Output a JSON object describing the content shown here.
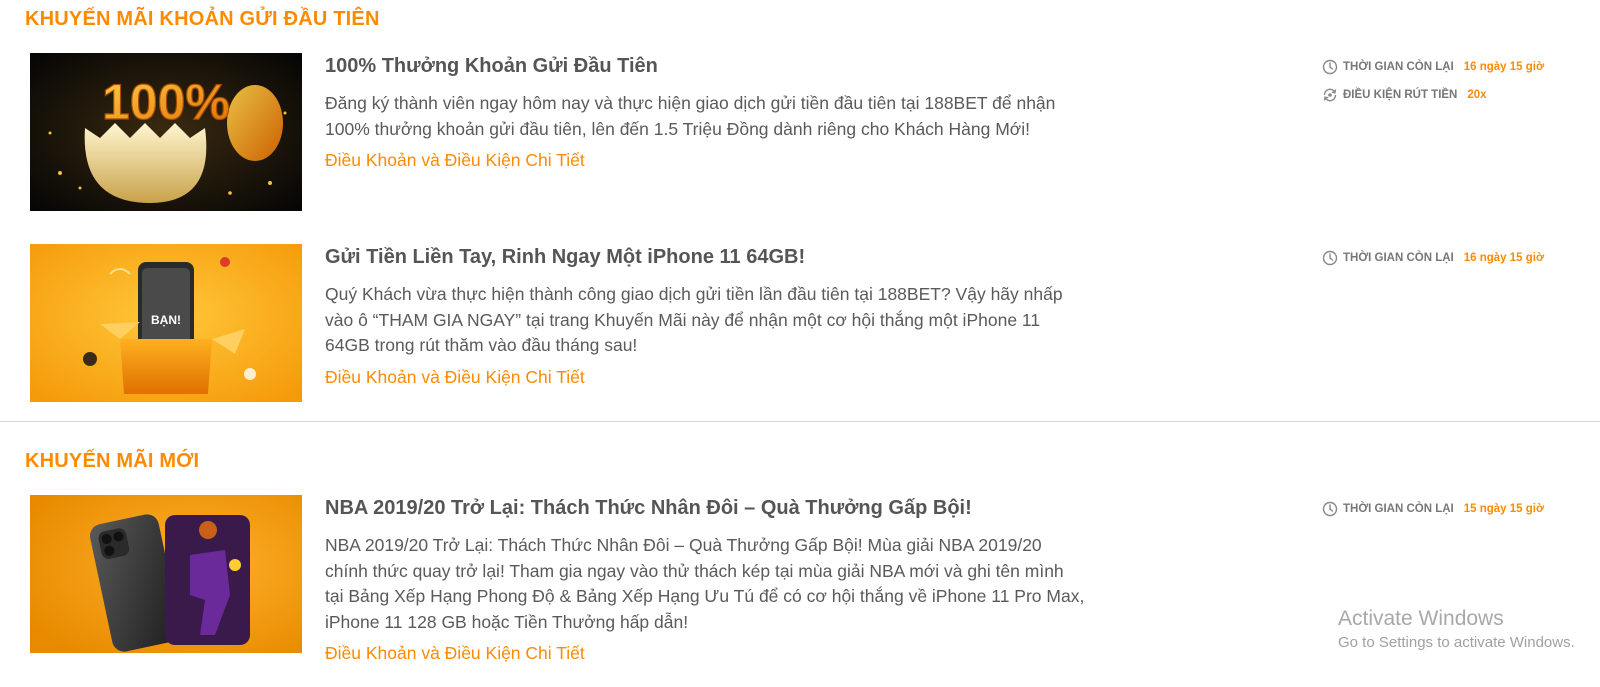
{
  "sections": [
    {
      "title": "KHUYẾN MÃI KHOẢN GỬI ĐẦU TIÊN"
    },
    {
      "title": "KHUYẾN MÃI MỚI"
    }
  ],
  "promos": [
    {
      "image": "100-percent-golden-egg-banner",
      "image_text": "100%",
      "title": "100% Thưởng Khoản Gửi Đầu Tiên",
      "description": "Đăng ký thành viên ngay hôm nay và thực hiện giao dịch gửi tiền đầu tiên tại 188BET để nhận 100% thưởng khoản gửi đầu tiên, lên đến 1.5 Triệu Đồng dành riêng cho Khách Hàng Mới!",
      "link": "Điều Khoản và Điều Kiện Chi Tiết",
      "meta": [
        {
          "icon": "clock-icon",
          "label": "THỜI GIAN CÒN LẠI",
          "value": "16 ngày 15 giờ"
        },
        {
          "icon": "rollover-icon",
          "label": "ĐIỀU KIỆN RÚT TIỀN",
          "value": "20x"
        }
      ]
    },
    {
      "image": "iphone-gift-box-banner",
      "image_text": "BẠN!",
      "title": "Gửi Tiền Liền Tay, Rinh Ngay Một iPhone 11 64GB!",
      "description": "Quý Khách vừa thực hiện thành công giao dịch gửi tiền lần đầu tiên tại 188BET? Vậy hãy nhấp vào ô “THAM GIA NGAY” tại trang Khuyến Mãi này để nhận một cơ hội thắng một iPhone 11 64GB trong rút thăm vào đầu tháng sau!",
      "link": "Điều Khoản và Điều Kiện Chi Tiết",
      "meta": [
        {
          "icon": "clock-icon",
          "label": "THỜI GIAN CÒN LẠI",
          "value": "16 ngày 15 giờ"
        }
      ]
    },
    {
      "image": "nba-iphone-11-pro-banner",
      "title": "NBA 2019/20 Trở Lại: Thách Thức Nhân Đôi – Quà Thưởng Gấp Bội!",
      "description": "NBA 2019/20 Trở Lại: Thách Thức Nhân Đôi – Quà Thưởng Gấp Bội! Mùa giải NBA 2019/20 chính thức quay trở lại! Tham gia ngay vào thử thách kép tại mùa giải NBA mới và ghi tên mình tại Bảng Xếp Hạng Phong Độ & Bảng Xếp Hạng Ưu Tú để có cơ hội thắng về iPhone 11 Pro Max, iPhone 11 128 GB hoặc Tiền Thưởng hấp dẫn!",
      "link": "Điều Khoản và Điều Kiện Chi Tiết",
      "meta": [
        {
          "icon": "clock-icon",
          "label": "THỜI GIAN CÒN LẠI",
          "value": "15 ngày 15 giờ"
        }
      ]
    }
  ],
  "watermark": {
    "title": "Activate Windows",
    "subtitle": "Go to Settings to activate Windows."
  },
  "colors": {
    "accent": "#ff8a00",
    "title_text": "#555555",
    "body_text": "#5a5a5a",
    "divider": "#d9d9d9"
  }
}
